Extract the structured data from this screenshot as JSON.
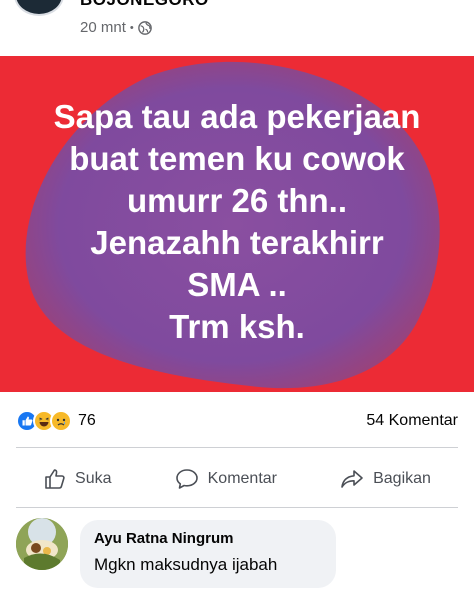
{
  "post": {
    "author": "BOJONEGORO",
    "time": "20 mnt",
    "separator": "•",
    "privacy_icon": "globe-icon",
    "background_color": "#ec2b35",
    "blob_color": "#8a4fa0",
    "lines": [
      "Sapa tau ada pekerjaan",
      "buat temen ku cowok",
      "umurr 26 thn..",
      "Jenazahh terakhirr",
      "SMA ..",
      "Trm ksh."
    ]
  },
  "reactions": {
    "icons": [
      "like-reaction-icon",
      "haha-reaction-icon",
      "sad-reaction-icon"
    ],
    "count": "76",
    "comments_label": "54 Komentar"
  },
  "actions": {
    "like_label": "Suka",
    "comment_label": "Komentar",
    "share_label": "Bagikan"
  },
  "comment": {
    "name": "Ayu Ratna Ningrum",
    "text": "Mgkn maksudnya ijabah"
  },
  "colors": {
    "text_secondary": "#65676b",
    "divider": "#ced0d4",
    "bubble": "#f0f2f5",
    "like_blue": "#1877f2",
    "reaction_yellow": "#f7b928"
  }
}
